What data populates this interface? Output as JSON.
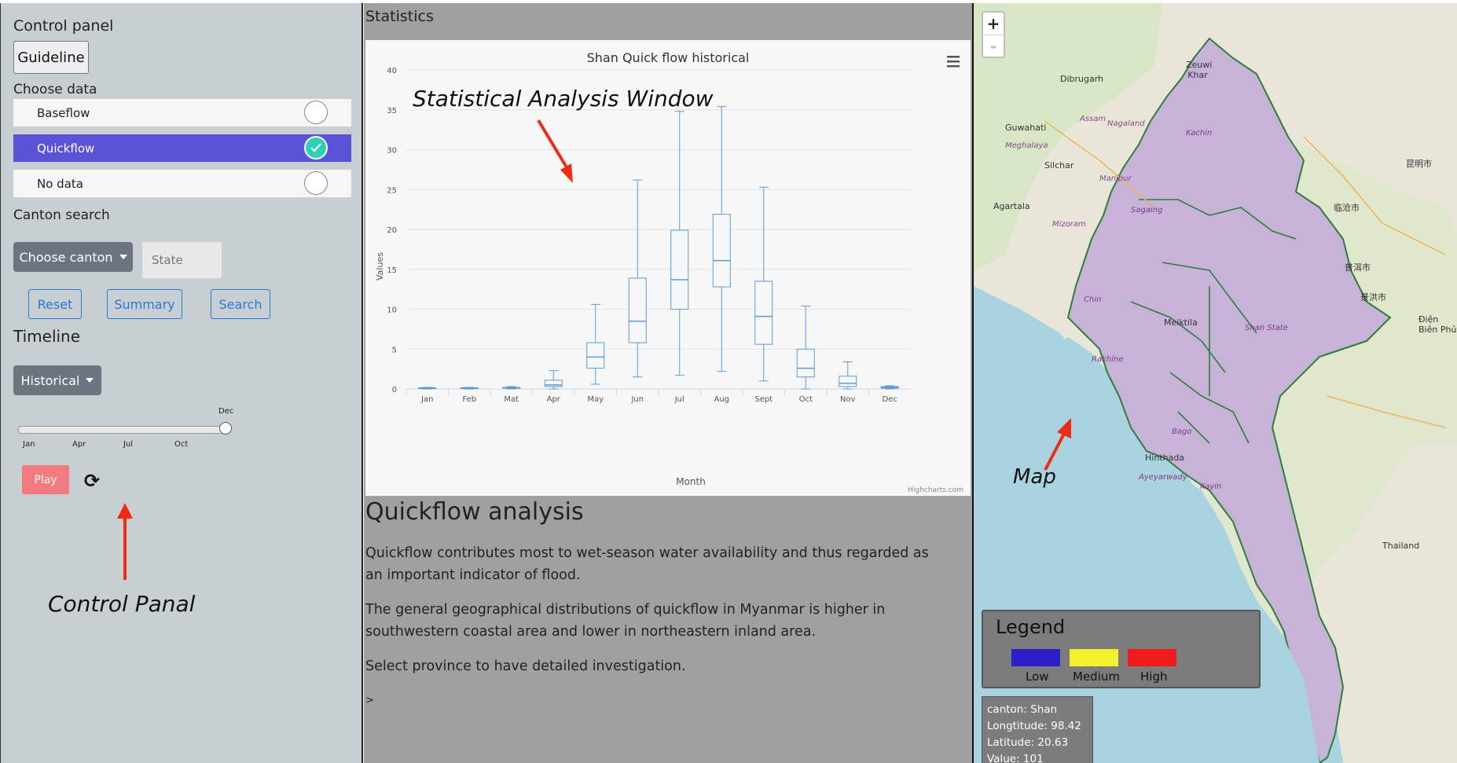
{
  "control_panel": {
    "title": "Control panel",
    "guideline_label": "Guideline",
    "choose_data_label": "Choose data",
    "data_options": [
      {
        "label": "Baseflow",
        "selected": false
      },
      {
        "label": "Quickflow",
        "selected": true
      },
      {
        "label": "No data",
        "selected": false
      }
    ],
    "canton_search_label": "Canton search",
    "choose_canton_label": "Choose canton",
    "state_placeholder": "State",
    "reset_label": "Reset",
    "summary_label": "Summary",
    "search_label": "Search",
    "timeline_label": "Timeline",
    "timeline_mode": "Historical",
    "slider": {
      "value_label": "Dec",
      "ticks": [
        "Jan",
        "Apr",
        "Jul",
        "Oct"
      ],
      "position_fraction": 1.0
    },
    "play_label": "Play",
    "refresh_icon": "refresh-icon"
  },
  "annotations": {
    "control": "Control Panal",
    "stats": "Statistical Analysis Window",
    "map": "Map"
  },
  "statistics": {
    "header": "Statistics",
    "credit": "Highcharts.com",
    "menu_icon": "hamburger-menu-icon"
  },
  "chart_data": {
    "type": "boxplot",
    "title": "Shan Quick flow historical",
    "xlabel": "Month",
    "ylabel": "Values",
    "ylim": [
      0,
      40
    ],
    "yticks": [
      0,
      5,
      10,
      15,
      20,
      25,
      30,
      35,
      40
    ],
    "categories": [
      "Jan",
      "Feb",
      "Mat",
      "Apr",
      "May",
      "Jun",
      "Jul",
      "Aug",
      "Sept",
      "Oct",
      "Nov",
      "Dec"
    ],
    "boxes": [
      {
        "low": 0.0,
        "q1": 0.05,
        "median": 0.1,
        "q3": 0.15,
        "high": 0.2
      },
      {
        "low": 0.0,
        "q1": 0.05,
        "median": 0.1,
        "q3": 0.15,
        "high": 0.2
      },
      {
        "low": 0.0,
        "q1": 0.1,
        "median": 0.15,
        "q3": 0.2,
        "high": 0.3
      },
      {
        "low": 0.0,
        "q1": 0.3,
        "median": 0.5,
        "q3": 1.1,
        "high": 2.3
      },
      {
        "low": 0.6,
        "q1": 2.6,
        "median": 4.0,
        "q3": 5.8,
        "high": 10.6
      },
      {
        "low": 1.5,
        "q1": 5.8,
        "median": 8.5,
        "q3": 13.9,
        "high": 26.2
      },
      {
        "low": 1.7,
        "q1": 10.0,
        "median": 13.7,
        "q3": 19.9,
        "high": 34.8
      },
      {
        "low": 2.2,
        "q1": 12.8,
        "median": 16.1,
        "q3": 21.9,
        "high": 35.4
      },
      {
        "low": 1.0,
        "q1": 5.6,
        "median": 9.1,
        "q3": 13.5,
        "high": 25.3
      },
      {
        "low": 0.0,
        "q1": 1.5,
        "median": 2.6,
        "q3": 5.0,
        "high": 10.4
      },
      {
        "low": 0.0,
        "q1": 0.3,
        "median": 0.7,
        "q3": 1.6,
        "high": 3.4
      },
      {
        "low": 0.0,
        "q1": 0.1,
        "median": 0.2,
        "q3": 0.3,
        "high": 0.4
      }
    ],
    "color": "#5b9bd5",
    "grid": true
  },
  "analysis": {
    "title": "Quickflow analysis",
    "p1": "Quickflow contributes most to wet-season water availability and thus regarded as an important indicator of flood.",
    "p2": "The general geographical distributions of quickflow in Myanmar is higher in southwestern coastal area and lower in northeastern inland area.",
    "p3": "Select province to have detailed investigation.",
    "p4": ">"
  },
  "map": {
    "zoom_in": "+",
    "zoom_out": "-",
    "legend": {
      "title": "Legend",
      "items": [
        {
          "label": "Low",
          "color": "#2b1fc9"
        },
        {
          "label": "Medium",
          "color": "#f2f22a"
        },
        {
          "label": "High",
          "color": "#f21a1a"
        }
      ]
    },
    "info": {
      "canton": "canton: Shan",
      "longitude": "Longtitude: 98.42",
      "latitude": "Latitude: 20.63",
      "value": "Value: 101"
    },
    "place_labels": [
      "Dibrugarh",
      "Guwahati",
      "Silchar",
      "Agartala",
      "Meghalaya",
      "Manipur",
      "Mizoram",
      "Nagaland",
      "Assam",
      "Shan State",
      "Ayeyarwady",
      "Chin",
      "Hinthada",
      "Meiktila",
      "Bago",
      "Kayin",
      "Kachin",
      "Sagaing",
      "Rakhine",
      "Zeuwi Khar",
      "昆明市",
      "临沧市",
      "普洱市",
      "景洪市",
      "Điện Biên Phủ",
      "Thailand"
    ]
  }
}
